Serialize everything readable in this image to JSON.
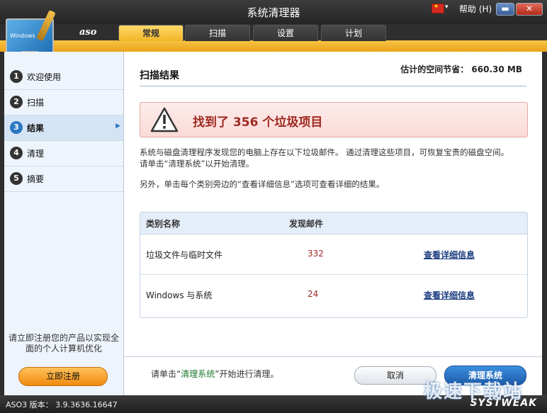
{
  "window": {
    "title": "系统清理器"
  },
  "titlebar": {
    "help_label": "帮助 (H)",
    "minimize_symbol": "▬",
    "close_symbol": "✕"
  },
  "logo": {
    "monitor_text": "Windows",
    "brand": "aso"
  },
  "tabs": [
    {
      "label": "常规",
      "active": true
    },
    {
      "label": "扫描",
      "active": false
    },
    {
      "label": "设置",
      "active": false
    },
    {
      "label": "计划",
      "active": false
    }
  ],
  "sidebar": {
    "steps": [
      {
        "num": "1",
        "label": "欢迎使用"
      },
      {
        "num": "2",
        "label": "扫描"
      },
      {
        "num": "3",
        "label": "结果",
        "active": true
      },
      {
        "num": "4",
        "label": "清理"
      },
      {
        "num": "5",
        "label": "摘要"
      }
    ],
    "promo_text": "请立即注册您的产品以实现全面的个人计算机优化",
    "register_label": "立即注册"
  },
  "main": {
    "heading": "扫描结果",
    "savings": "估计的空间节省： 660.30 MB",
    "alert_text": "找到了 356 个垃圾项目",
    "desc_line1": "系统与磁盘清理程序发现您的电脑上存在以下垃圾邮件。 通过清理这些项目，可恢复宝贵的磁盘空间。",
    "desc_line2": "请单击“清理系统”以开始清理。",
    "desc_line3": "另外，单击每个类别旁边的“查看详细信息”选项可查看详细的结果。",
    "table": {
      "col_category": "类别名称",
      "col_found": "发现邮件",
      "rows": [
        {
          "name": "垃圾文件与临时文件",
          "count": "332",
          "link": "查看详细信息"
        },
        {
          "name": "Windows 与系统",
          "count": "24",
          "link": "查看详细信息"
        }
      ]
    },
    "footer_prefix": "请单击“",
    "footer_highlight": "清理系统",
    "footer_suffix": "”开始进行清理。",
    "cancel_label": "取消",
    "clean_label": "清理系统"
  },
  "statusbar": {
    "version": "ASO3 版本： 3.9.3636.16647",
    "brand": "SYSTWEAK"
  },
  "watermark": "极速下载站",
  "colors": {
    "accent": "#f2b526",
    "alert": "#9e2a21",
    "primary": "#1d5aa8",
    "highlight": "#1b7a2b"
  }
}
